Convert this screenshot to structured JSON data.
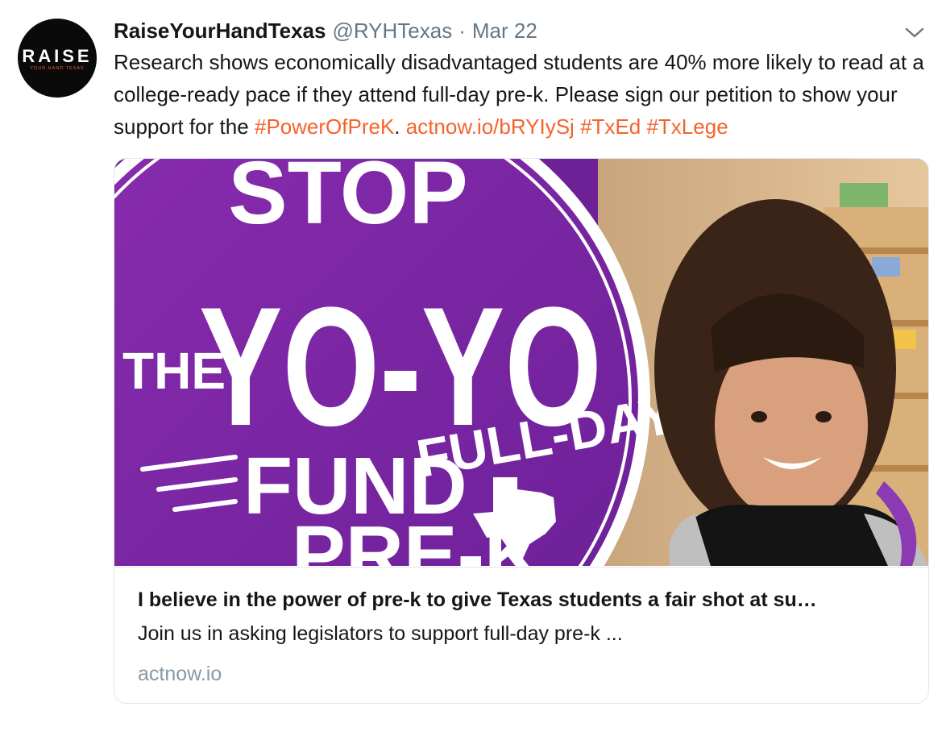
{
  "tweet": {
    "author_name": "RaiseYourHandTexas",
    "handle": "@RYHTexas",
    "separator": "·",
    "date": "Mar 22",
    "avatar": {
      "logo_main": "RAISE",
      "logo_sub": "YOUR HAND TEXAS"
    },
    "text_plain_1": "Research shows economically disadvantaged students are 40% more likely to read at a college-ready pace if they attend full-day pre-k. Please sign our petition to show your support for the ",
    "hashtag_power": "#PowerOfPreK",
    "text_plain_2": ". ",
    "link_url": "actnow.io/bRYIySj",
    "hashtag_txed": "#TxEd",
    "hashtag_txlege": "#TxLege",
    "menu_icon": "chevron-down-icon"
  },
  "card": {
    "image_text": {
      "line1": "STOP",
      "line2a": "THE",
      "line2b": "YO-YO",
      "line3a": "FUND",
      "line3b": "FULL-DAY",
      "line4": "PRE-K"
    },
    "title": "I believe in the power of pre-k to give Texas students a fair shot at su…",
    "description": "Join us in asking legislators to support full-day pre-k ...",
    "domain": "actnow.io"
  },
  "colors": {
    "link": "#f4632c",
    "purple": "#7b2aa0",
    "secondary_text": "#657786",
    "domain_text": "#8899a6"
  }
}
